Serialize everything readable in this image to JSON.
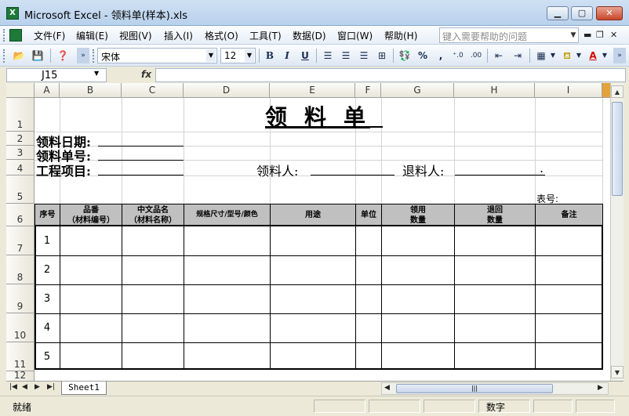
{
  "window": {
    "title": "Microsoft Excel - 领料单(样本).xls",
    "app_icon": "excel-icon"
  },
  "menu": {
    "items": [
      "文件(F)",
      "编辑(E)",
      "视图(V)",
      "插入(I)",
      "格式(O)",
      "工具(T)",
      "数据(D)",
      "窗口(W)",
      "帮助(H)"
    ],
    "help_placeholder": "键入需要帮助的问题"
  },
  "toolbar": {
    "font": "宋体",
    "size": "12",
    "bold": "B",
    "italic": "I",
    "underline": "U",
    "percent": "%",
    "comma": ","
  },
  "formula_bar": {
    "cell_ref": "J15",
    "fx": "fx",
    "content": ""
  },
  "columns": [
    "A",
    "B",
    "C",
    "D",
    "E",
    "F",
    "G",
    "H",
    "I"
  ],
  "rows": [
    "1",
    "2",
    "3",
    "4",
    "5",
    "6",
    "7",
    "8",
    "9",
    "10",
    "11",
    "12"
  ],
  "sheet": {
    "title": "领料单",
    "date_label": "领料日期:",
    "order_label": "领料单号:",
    "project_label": "工程项目:",
    "receiver_label": "领料人:",
    "returner_label": "退料人:",
    "returner_end": ".",
    "form_no_label": "表号:",
    "headers": [
      "序号",
      "品番\n（材料编号）",
      "中文品名\n（材料名称）",
      "规格尺寸/型号/颜色",
      "用途",
      "单位",
      "领用\n数量",
      "退回\n数量",
      "备注"
    ],
    "row_numbers": [
      "1",
      "2",
      "3",
      "4",
      "5"
    ]
  },
  "tabs": {
    "sheet_name": "Sheet1"
  },
  "status": {
    "ready": "就绪",
    "num": "数字"
  }
}
